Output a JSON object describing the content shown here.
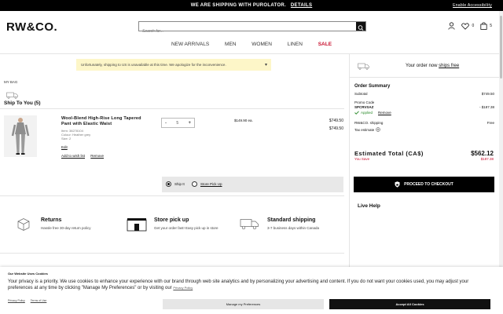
{
  "topbar": {
    "message": "WE ARE SHIPPING WITH PUROLATOR.",
    "details": "DETAILS",
    "accessibility": "Enable Accessibility"
  },
  "header": {
    "logo": "RW&CO.",
    "search_placeholder": "Search for...",
    "wishlist_count": "0",
    "cart_count": "5"
  },
  "nav": {
    "items": [
      "NEW ARRIVALS",
      "MEN",
      "WOMEN",
      "LINEN"
    ],
    "sale": "SALE"
  },
  "alert": {
    "text": "Unfortunately, shipping to US is unavailable at this time. We apologize for the inconvenience."
  },
  "bag": {
    "title": "MY BAG",
    "ship_title": "Ship To You (5)",
    "product": {
      "name": "Wool-Blend High-Rise Long Tapered Pant with Elastic Waist",
      "item": "Item: 38278104",
      "colour": "Colour: Heather grey",
      "size": "Size: 2",
      "edit": "Edit",
      "wishlist": "Add to wish list",
      "remove": "Remove",
      "qty": "5",
      "each": "$149.90 ea.",
      "price": "$749.50",
      "subtotal": "$749.50"
    },
    "ship_option": "Ship It",
    "pickup_option": "Store Pick Up"
  },
  "features": [
    {
      "title": "Returns",
      "desc": "Hassle free 30-day return policy"
    },
    {
      "title": "Store pick up",
      "desc": "Get your order fast! Easy pick up in store"
    },
    {
      "title": "Standard shipping",
      "desc": "3-7 business days within Canada"
    }
  ],
  "summary": {
    "free_ship_text": "Your order now",
    "free_ship_link": "ships free",
    "title": "Order Summary",
    "subtotal_label": "Subtotal",
    "subtotal_value": "$749.50",
    "promo_label": "Promo Code",
    "promo_code": "SPCRVSAZ",
    "promo_value": "- $187.38",
    "applied": "Applied",
    "remove": "Remove",
    "shipping_label": "RW&CO. shipping",
    "shipping_value": "Free",
    "tax_label": "Tax estimate",
    "estimated_label": "Estimated Total (CA$)",
    "estimated_value": "$562.12",
    "save_label": "You Save",
    "save_value": "$187.38",
    "checkout": "PROCEED TO CHECKOUT",
    "live_help": "Live Help"
  },
  "cookie": {
    "title": "Our Website Uses Cookies",
    "body": "Your privacy is a priority. We use cookies to enhance your experience with our brand through web site analytics and by personalizing your advertising and content. If you do not want your cookies used, you may adjust your preferences at any time by clicking \"Manage My Preferences\" or by visiting our",
    "privacy_link": "Privacy Policy",
    "privacy_policy": "Privacy Policy",
    "terms": "Terms of Use",
    "manage": "Manage my Preferences",
    "accept": "Accept All Cookies"
  }
}
